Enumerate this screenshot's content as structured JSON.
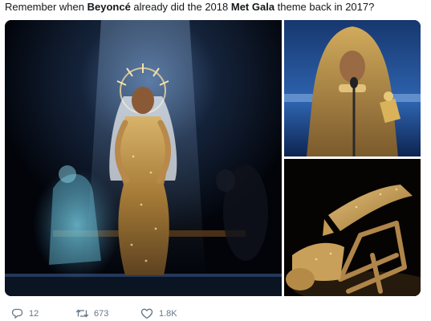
{
  "tweet": {
    "text_parts": {
      "p1": "Remember when ",
      "b1": "Beyoncé",
      "p2": " already did the 2018 ",
      "b2": "Met Gala",
      "p3": " theme back in 2017?"
    }
  },
  "actions": {
    "reply": {
      "icon": "reply-icon",
      "count": "12"
    },
    "retweet": {
      "icon": "retweet-icon",
      "count": "673"
    },
    "like": {
      "icon": "heart-icon",
      "count": "1.8K"
    }
  },
  "colors": {
    "text": "#14171a",
    "muted": "#657786",
    "gold": "#c9a24a"
  }
}
